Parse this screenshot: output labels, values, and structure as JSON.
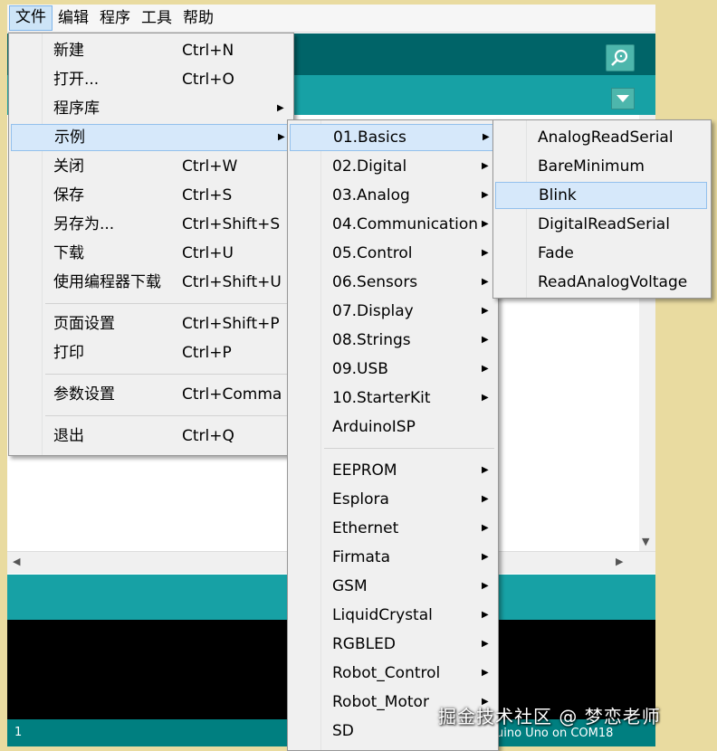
{
  "menubar": [
    "文件",
    "编辑",
    "程序",
    "工具",
    "帮助"
  ],
  "file_menu": [
    {
      "label": "新建",
      "shortcut": "Ctrl+N"
    },
    {
      "label": "打开...",
      "shortcut": "Ctrl+O"
    },
    {
      "label": "程序库",
      "shortcut": "",
      "submenu": true
    },
    {
      "label": "示例",
      "shortcut": "",
      "submenu": true,
      "highlighted": true
    },
    {
      "label": "关闭",
      "shortcut": "Ctrl+W"
    },
    {
      "label": "保存",
      "shortcut": "Ctrl+S"
    },
    {
      "label": "另存为...",
      "shortcut": "Ctrl+Shift+S"
    },
    {
      "label": "下载",
      "shortcut": "Ctrl+U"
    },
    {
      "label": "使用编程器下载",
      "shortcut": "Ctrl+Shift+U"
    },
    {
      "label": "页面设置",
      "shortcut": "Ctrl+Shift+P"
    },
    {
      "label": "打印",
      "shortcut": "Ctrl+P"
    },
    {
      "label": "参数设置",
      "shortcut": "Ctrl+Comma"
    },
    {
      "label": "退出",
      "shortcut": "Ctrl+Q"
    }
  ],
  "examples_menu": [
    "01.Basics",
    "02.Digital",
    "03.Analog",
    "04.Communication",
    "05.Control",
    "06.Sensors",
    "07.Display",
    "08.Strings",
    "09.USB",
    "10.StarterKit",
    "ArduinoISP",
    "EEPROM",
    "Esplora",
    "Ethernet",
    "Firmata",
    "GSM",
    "LiquidCrystal",
    "RGBLED",
    "Robot_Control",
    "Robot_Motor",
    "SD"
  ],
  "basics_menu": [
    "AnalogReadSerial",
    "BareMinimum",
    "Blink",
    "DigitalReadSerial",
    "Fade",
    "ReadAnalogVoltage"
  ],
  "status": {
    "line": "1",
    "board": "uino Uno on COM18"
  },
  "watermark": "掘金技术社区 @ 梦恋老师",
  "colors": {
    "toolbar": "#006468",
    "tabbar": "#17a1a5",
    "highlight": "#d6e8fa"
  }
}
